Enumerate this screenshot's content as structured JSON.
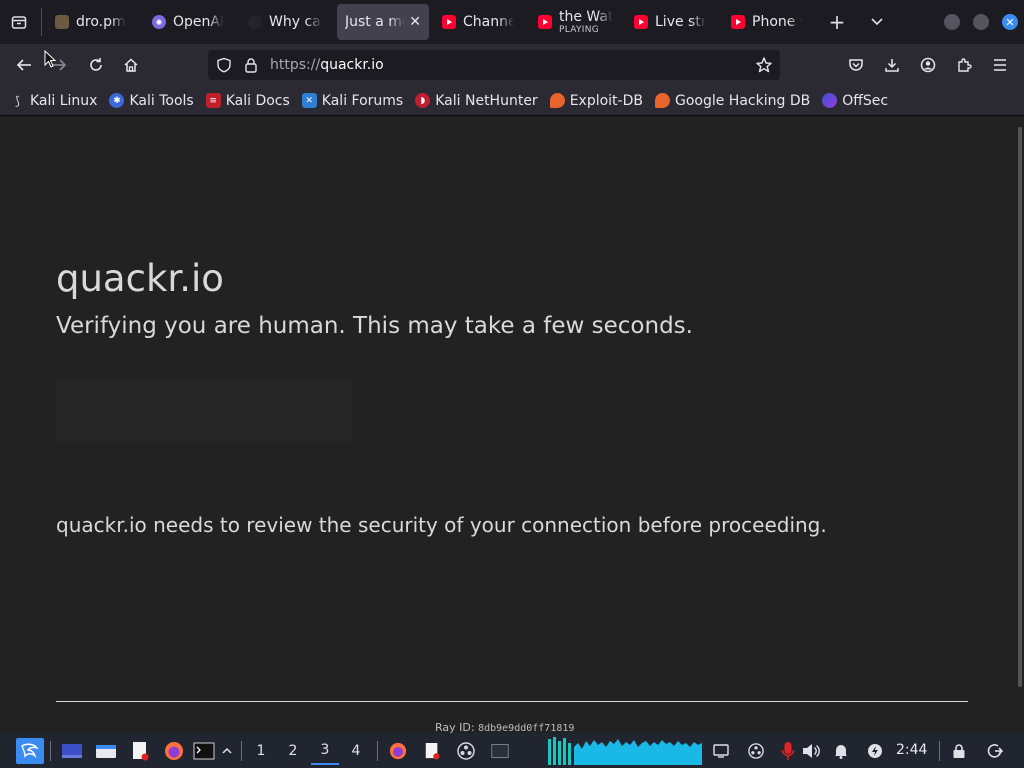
{
  "tabs": [
    {
      "label": "dro.pm",
      "icon": "file-icon",
      "active": false
    },
    {
      "label": "OpenAI",
      "icon": "openai-icon",
      "active": false
    },
    {
      "label": "Why can",
      "icon": "github-icon",
      "active": false
    },
    {
      "label": "Just a moment",
      "icon": "none",
      "active": true
    },
    {
      "label": "Channel",
      "icon": "youtube-icon",
      "active": false
    },
    {
      "label": "the Wat",
      "sublabel": "PLAYING",
      "icon": "youtube-icon",
      "active": false
    },
    {
      "label": "Live stre",
      "icon": "youtube-icon",
      "active": false
    },
    {
      "label": "Phone v",
      "icon": "youtube-icon",
      "active": false
    }
  ],
  "navbar": {
    "url_protocol": "https://",
    "url_host": "quackr.io"
  },
  "bookmarks": [
    {
      "label": "Kali Linux",
      "icon": "kali-dragon-icon"
    },
    {
      "label": "Kali Tools",
      "icon": "kali-tools-icon"
    },
    {
      "label": "Kali Docs",
      "icon": "kali-docs-icon"
    },
    {
      "label": "Kali Forums",
      "icon": "kali-forums-icon"
    },
    {
      "label": "Kali NetHunter",
      "icon": "nethunter-icon"
    },
    {
      "label": "Exploit-DB",
      "icon": "exploit-db-icon"
    },
    {
      "label": "Google Hacking DB",
      "icon": "ghdb-icon"
    },
    {
      "label": "OffSec",
      "icon": "offsec-icon"
    }
  ],
  "page": {
    "site_title": "quackr.io",
    "verify_message": "Verifying you are human. This may take a few seconds.",
    "security_message": "quackr.io needs to review the security of your connection before proceeding.",
    "ray_label": "Ray ID:",
    "ray_value": "8db9e9dd0ff71819"
  },
  "taskbar": {
    "workspaces": [
      "1",
      "2",
      "3",
      "4"
    ],
    "active_workspace": "3",
    "clock": "2:44"
  },
  "colors": {
    "page_bg": "#222222",
    "chrome_bg": "#2b2a33",
    "tab_bar_bg": "#1c1b22",
    "accent": "#3b8cf0"
  }
}
